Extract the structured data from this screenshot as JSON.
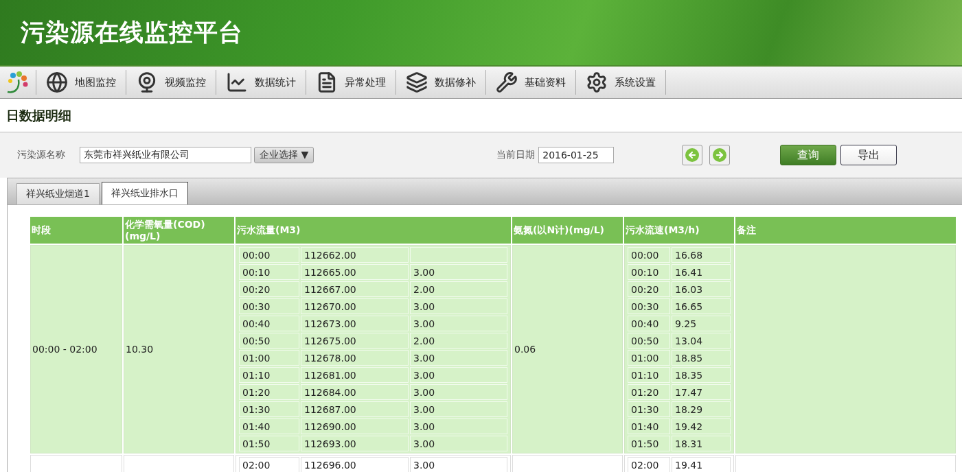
{
  "header": {
    "title": "污染源在线监控平台"
  },
  "nav": [
    {
      "kind": "map",
      "label": "地图监控"
    },
    {
      "kind": "video",
      "label": "视频监控"
    },
    {
      "kind": "stats",
      "label": "数据统计"
    },
    {
      "kind": "exception",
      "label": "异常处理"
    },
    {
      "kind": "repair",
      "label": "数据修补"
    },
    {
      "kind": "basic",
      "label": "基础资料"
    },
    {
      "kind": "settings",
      "label": "系统设置"
    }
  ],
  "page_title": "日数据明细",
  "filters": {
    "source_label": "污染源名称",
    "source_value": "东莞市祥兴纸业有限公司",
    "select_button": "企业选择 ▼",
    "date_label": "当前日期",
    "date_value": "2016-01-25",
    "query_button": "查询",
    "export_button": "导出"
  },
  "tabs": [
    {
      "label": "祥兴纸业烟道1",
      "selected": false
    },
    {
      "label": "祥兴纸业排水口",
      "selected": true
    }
  ],
  "table": {
    "columns": [
      "时段",
      "化学需氧量(COD)(mg/L)",
      "污水流量(M3)",
      "氨氮(以N计)(mg/L)",
      "污水流速(M3/h)",
      "备注"
    ],
    "rows": [
      {
        "highlighted": true,
        "period": "00:00 - 02:00",
        "cod": "10.30",
        "ammonia": "0.06",
        "flow": [
          {
            "time": "00:00",
            "total": "112662.00"
          },
          {
            "time": "00:10",
            "total": "112665.00",
            "increment": "3.00"
          },
          {
            "time": "00:20",
            "total": "112667.00",
            "increment": "2.00"
          },
          {
            "time": "00:30",
            "total": "112670.00",
            "increment": "3.00"
          },
          {
            "time": "00:40",
            "total": "112673.00",
            "increment": "3.00"
          },
          {
            "time": "00:50",
            "total": "112675.00",
            "increment": "2.00"
          },
          {
            "time": "01:00",
            "total": "112678.00",
            "increment": "3.00"
          },
          {
            "time": "01:10",
            "total": "112681.00",
            "increment": "3.00"
          },
          {
            "time": "01:20",
            "total": "112684.00",
            "increment": "3.00"
          },
          {
            "time": "01:30",
            "total": "112687.00",
            "increment": "3.00"
          },
          {
            "time": "01:40",
            "total": "112690.00",
            "increment": "3.00"
          },
          {
            "time": "01:50",
            "total": "112693.00",
            "increment": "3.00"
          }
        ],
        "speed": [
          [
            "00:00",
            "16.68"
          ],
          [
            "00:10",
            "16.41"
          ],
          [
            "00:20",
            "16.03"
          ],
          [
            "00:30",
            "16.65"
          ],
          [
            "00:40",
            "9.25"
          ],
          [
            "00:50",
            "13.04"
          ],
          [
            "01:00",
            "18.85"
          ],
          [
            "01:10",
            "18.35"
          ],
          [
            "01:20",
            "17.47"
          ],
          [
            "01:30",
            "18.29"
          ],
          [
            "01:40",
            "19.42"
          ],
          [
            "01:50",
            "18.31"
          ]
        ]
      },
      {
        "highlighted": false,
        "flow": [
          {
            "time": "02:00",
            "total": "112696.00",
            "increment": "3.00"
          }
        ],
        "speed": [
          [
            "02:00",
            "19.41"
          ]
        ]
      }
    ]
  }
}
